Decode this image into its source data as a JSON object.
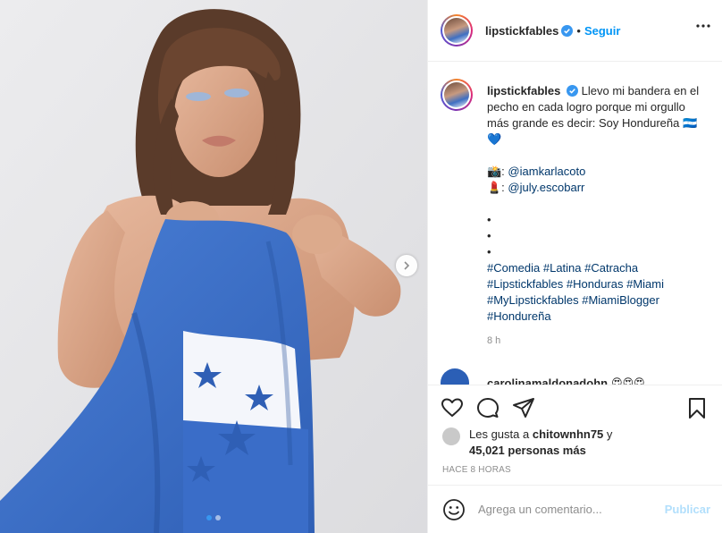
{
  "post": {
    "username": "lipstickfables",
    "follow_label": "Seguir",
    "separator": "•",
    "caption": {
      "username": "lipstickfables",
      "text": "Llevo mi bandera en el pecho en cada logro porque mi orgullo más grande es decir: Soy Hondureña 🇭🇳💙",
      "credits": [
        {
          "prefix": "📸: ",
          "handle": "@iamkarlacoto"
        },
        {
          "prefix": "💄: ",
          "handle": "@july.escobarr"
        }
      ],
      "dots": [
        "•",
        "•",
        "•"
      ],
      "hashtags_lines": [
        "#Comedia #Latina #Catracha",
        "#Lipstickfables #Honduras #Miami",
        "#MyLipstickfables #MiamiBlogger",
        "#Hondureña"
      ],
      "time": "8 h"
    },
    "comment": {
      "username": "carolinamaldonadohn",
      "text": "😍😍😍"
    },
    "likes": {
      "prefix": "Les gusta a",
      "user": "chitownhn75",
      "connector": "y",
      "count": "45,021 personas más"
    },
    "posted": "HACE 8 HORAS",
    "comment_input": {
      "placeholder": "Agrega un comentario..."
    },
    "publish_label": "Publicar",
    "carousel": {
      "count": 2,
      "active": 0
    }
  },
  "colors": {
    "accent": "#0095f6",
    "flag_blue": "#3f6fc2",
    "link": "#00376b",
    "muted": "#8e8e8e"
  },
  "icons": [
    "verified-badge-icon",
    "more-options-icon",
    "heart-icon",
    "comment-icon",
    "share-icon",
    "bookmark-icon",
    "emoji-icon",
    "chevron-right-icon"
  ]
}
